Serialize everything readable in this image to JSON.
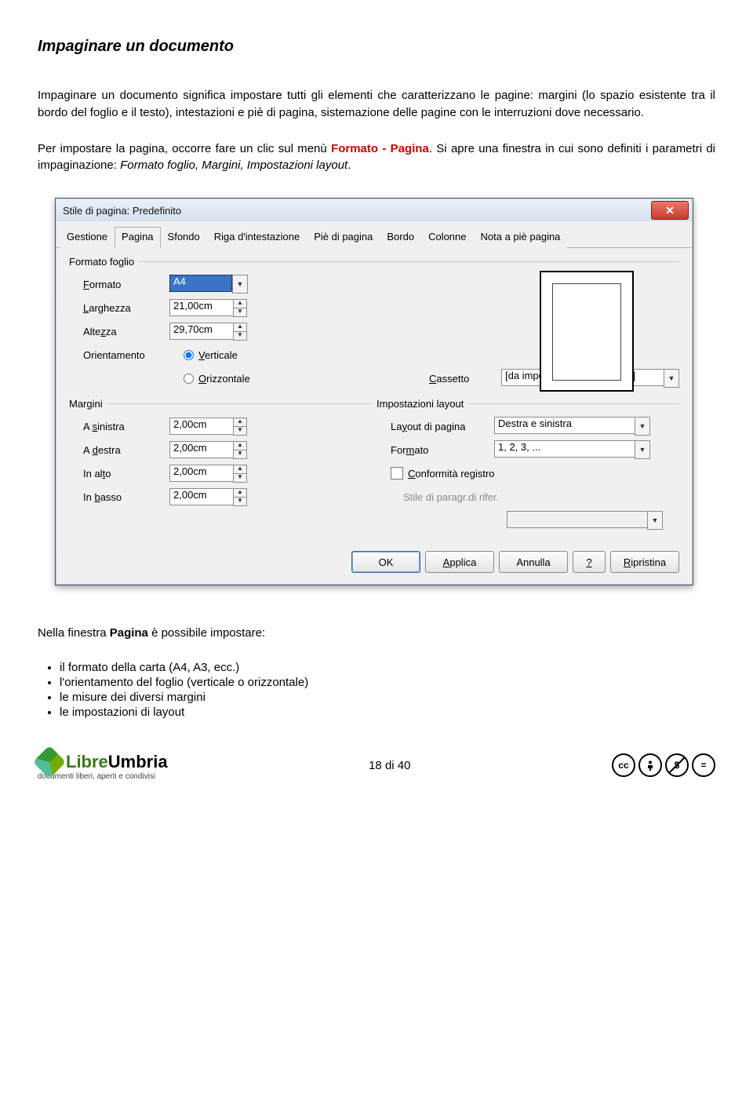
{
  "doc": {
    "title": "Impaginare un documento",
    "p1": "Impaginare un documento significa impostare tutti gli elementi che caratterizzano le pagine: margini (lo spazio esistente tra il bordo del foglio e il testo), intestazioni e piè di pagina, sistemazione delle pagine con le interruzioni dove necessario.",
    "p2a": "Per impostare la pagina, occorre fare un clic sul menù ",
    "p2b": "Formato - Pagina",
    "p2c": ". Si apre una finestra in cui sono definiti i parametri di impaginazione: ",
    "p2d": "Formato foglio, Margini, Impostazioni layout",
    "p2e": ".",
    "p3a": "Nella finestra ",
    "p3b": "Pagina",
    "p3c": " è possibile impostare:",
    "bullets": {
      "b1": "il formato della carta (A4, A3, ecc.)",
      "b2": "l'orientamento del foglio (verticale o orizzontale)",
      "b3": "le misure dei diversi margini",
      "b4": "le impostazioni di layout"
    }
  },
  "dialog": {
    "title": "Stile di pagina: Predefinito",
    "tabs": {
      "t0": "Gestione",
      "t1": "Pagina",
      "t2": "Sfondo",
      "t3": "Riga d'intestazione",
      "t4": "Piè di pagina",
      "t5": "Bordo",
      "t6": "Colonne",
      "t7": "Nota a piè pagina"
    },
    "group_format": "Formato foglio",
    "lbl_format": "Formato",
    "val_format": "A4",
    "lbl_width": "Larghezza",
    "val_width": "21,00cm",
    "lbl_height": "Altezza",
    "val_height": "29,70cm",
    "lbl_orient": "Orientamento",
    "radio_v": "Verticale",
    "radio_h": "Orizzontale",
    "lbl_tray": "Cassetto",
    "val_tray": "[da impostazione stampante]",
    "group_margins": "Margini",
    "lbl_left": "A sinistra",
    "val_left": "2,00cm",
    "lbl_right": "A destra",
    "val_right": "2,00cm",
    "lbl_top": "In alto",
    "val_top": "2,00cm",
    "lbl_bottom": "In basso",
    "val_bottom": "2,00cm",
    "group_layout": "Impostazioni layout",
    "lbl_pagelayout": "Layout di pagina",
    "val_pagelayout": "Destra e sinistra",
    "lbl_format2": "Formato",
    "val_format2": "1, 2, 3, ...",
    "chk_register": "Conformità registro",
    "lbl_refstyle": "Stile di paragr.di rifer.",
    "btn_ok": "OK",
    "btn_apply": "Applica",
    "btn_cancel": "Annulla",
    "btn_help": "?",
    "btn_reset": "Ripristina"
  },
  "footer": {
    "logo1": "Libre",
    "logo2": "Umbria",
    "logo_sub": "documenti liberi, aperti e condivisi",
    "page": "18 di 40",
    "cc1": "cc",
    "cc2": "BY",
    "cc3": "$",
    "cc4": "="
  },
  "chart_data": {
    "type": "table",
    "title": "Stile di pagina: Predefinito — Pagina tab",
    "fields": [
      {
        "group": "Formato foglio",
        "name": "Formato",
        "value": "A4"
      },
      {
        "group": "Formato foglio",
        "name": "Larghezza",
        "value": "21,00cm"
      },
      {
        "group": "Formato foglio",
        "name": "Altezza",
        "value": "29,70cm"
      },
      {
        "group": "Formato foglio",
        "name": "Orientamento",
        "value": "Verticale"
      },
      {
        "group": "Formato foglio",
        "name": "Cassetto",
        "value": "[da impostazione stampante]"
      },
      {
        "group": "Margini",
        "name": "A sinistra",
        "value": "2,00cm"
      },
      {
        "group": "Margini",
        "name": "A destra",
        "value": "2,00cm"
      },
      {
        "group": "Margini",
        "name": "In alto",
        "value": "2,00cm"
      },
      {
        "group": "Margini",
        "name": "In basso",
        "value": "2,00cm"
      },
      {
        "group": "Impostazioni layout",
        "name": "Layout di pagina",
        "value": "Destra e sinistra"
      },
      {
        "group": "Impostazioni layout",
        "name": "Formato",
        "value": "1, 2, 3, ..."
      },
      {
        "group": "Impostazioni layout",
        "name": "Conformità registro",
        "value": false
      }
    ]
  }
}
